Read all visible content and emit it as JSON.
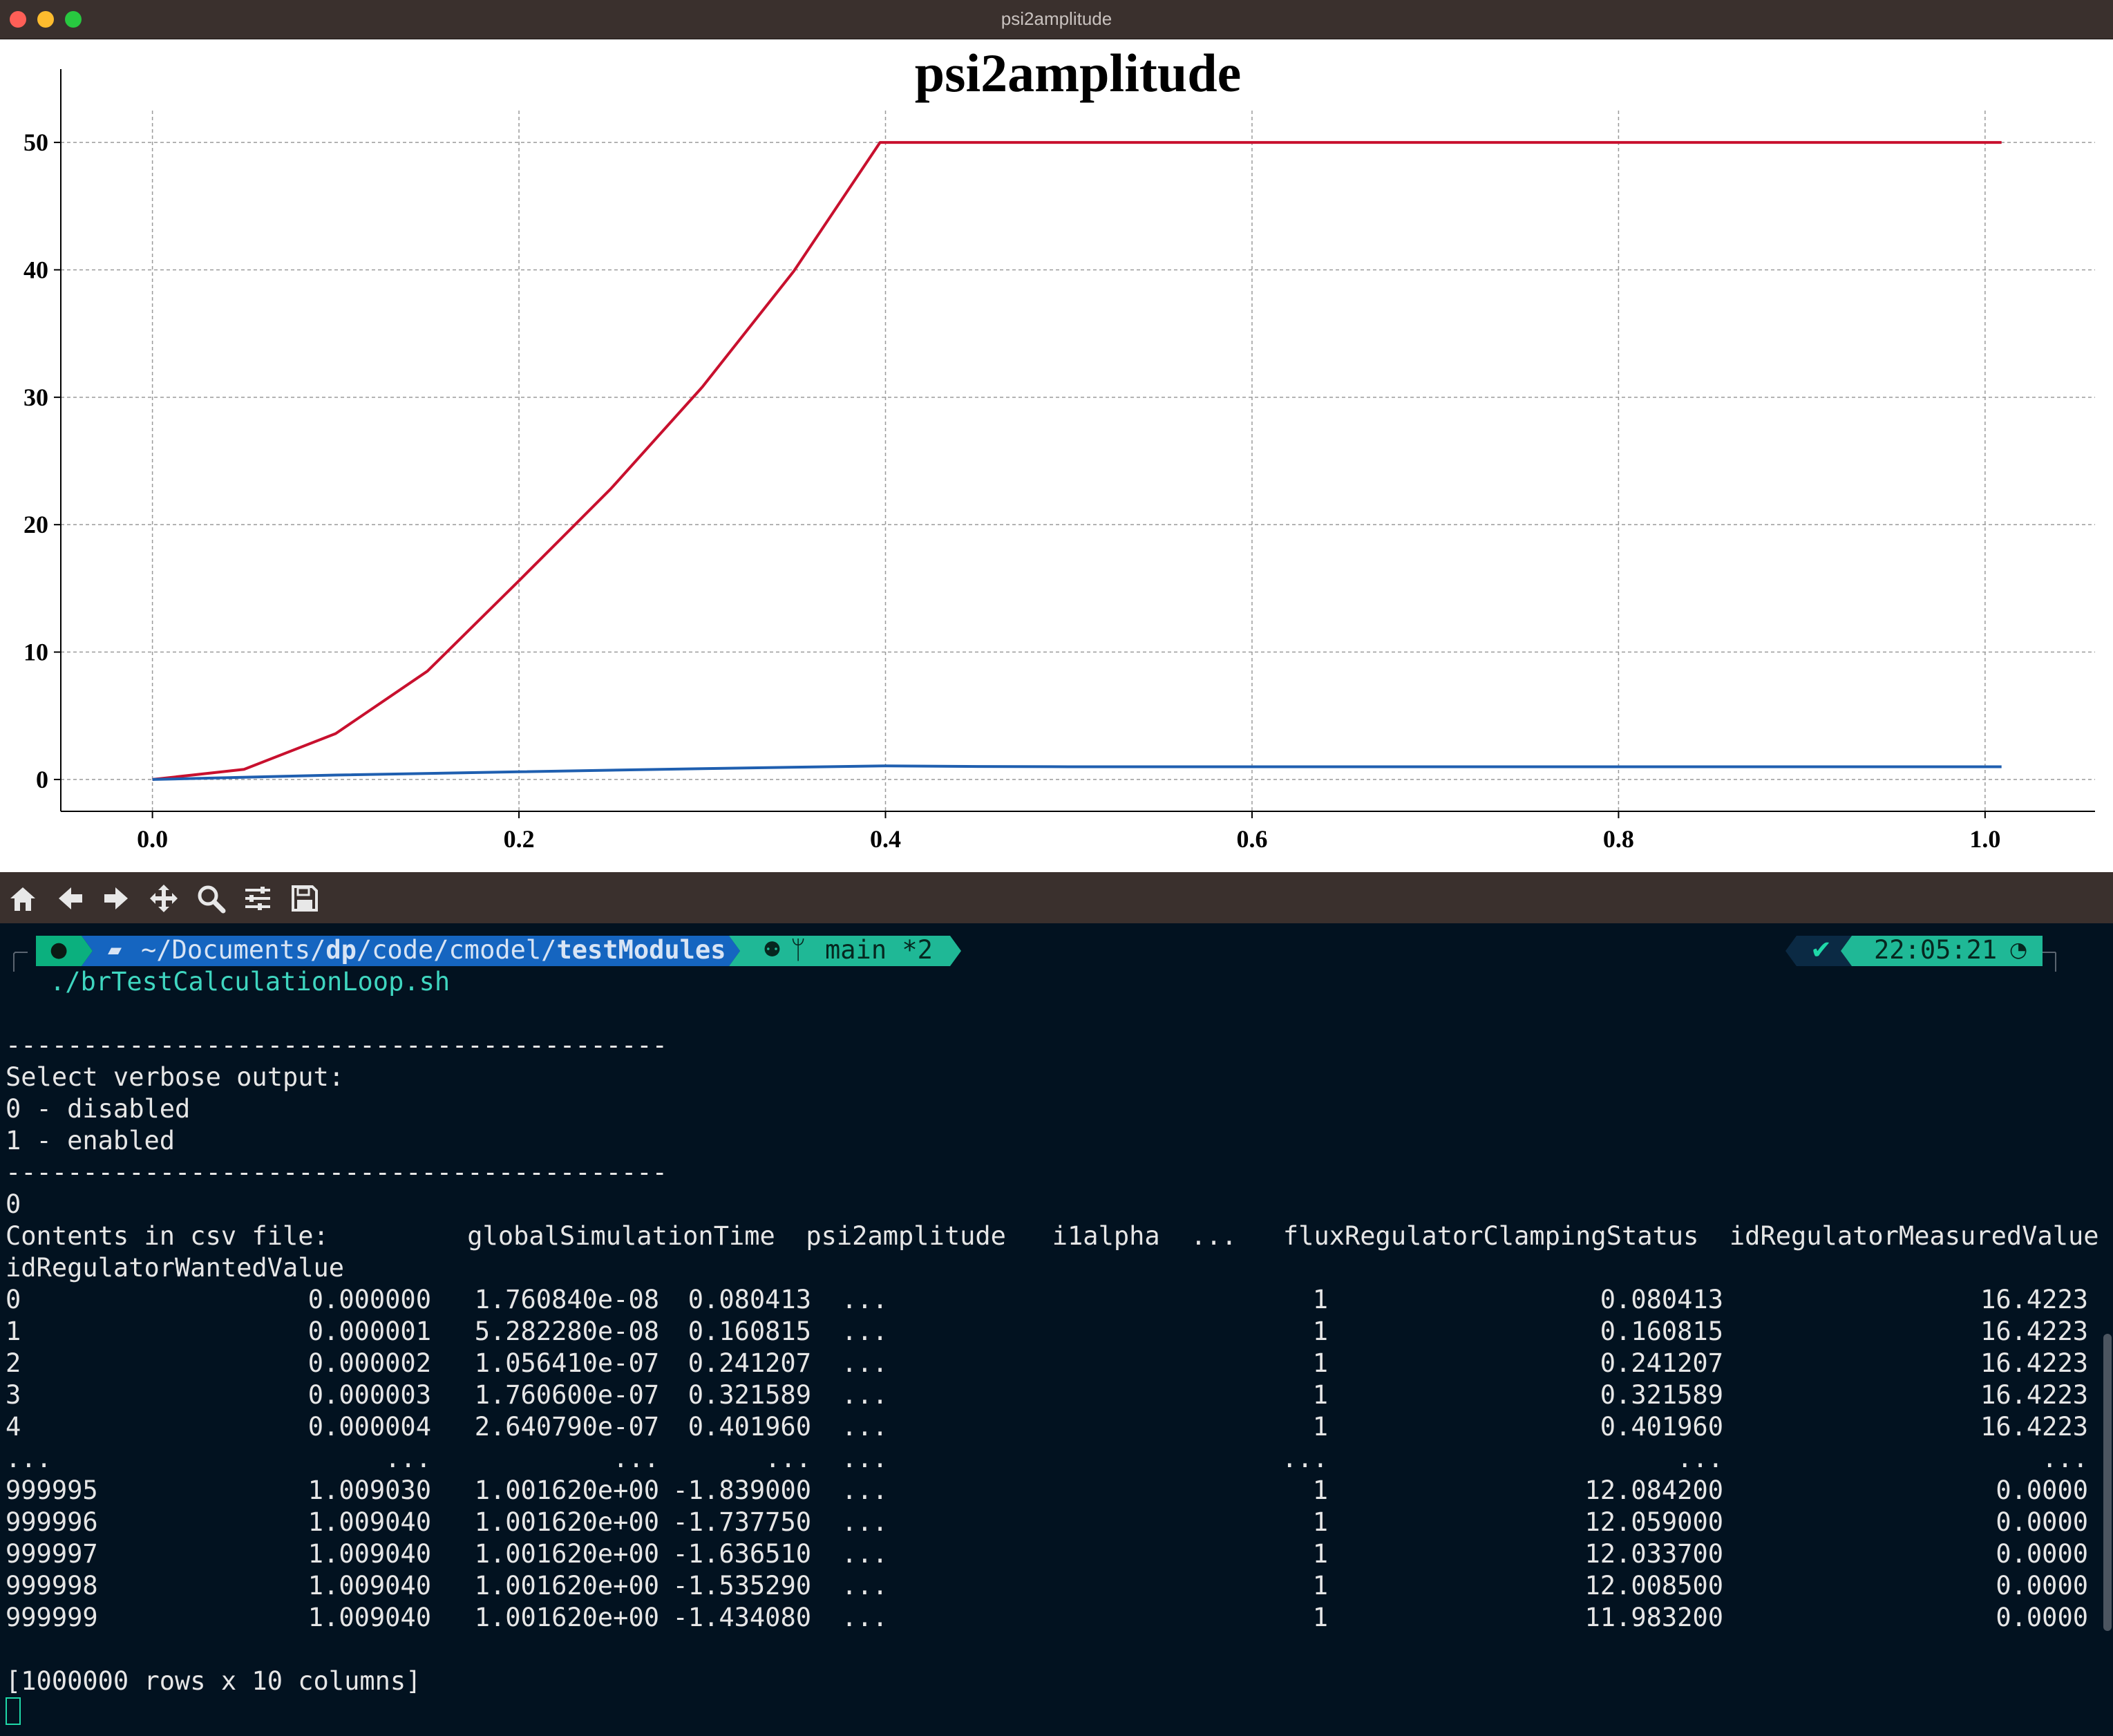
{
  "window": {
    "title": "psi2amplitude"
  },
  "chart_data": {
    "type": "line",
    "title": "psi2amplitude",
    "xlabel": "",
    "ylabel": "",
    "xlim": [
      -0.05,
      1.06
    ],
    "ylim": [
      -2.5,
      52.5
    ],
    "x_ticks": [
      "0.0",
      "0.2",
      "0.4",
      "0.6",
      "0.8",
      "1.0"
    ],
    "y_ticks": [
      "0",
      "10",
      "20",
      "30",
      "40",
      "50"
    ],
    "grid": true,
    "series": [
      {
        "color": "#c8102e",
        "x": [
          0.0,
          0.05,
          0.1,
          0.15,
          0.2,
          0.25,
          0.3,
          0.35,
          0.397,
          0.5,
          0.6,
          0.7,
          0.8,
          0.9,
          1.009
        ],
        "y": [
          0.0,
          0.8,
          3.6,
          8.5,
          15.6,
          22.8,
          30.8,
          39.9,
          50.0,
          50.0,
          50.0,
          50.0,
          50.0,
          50.0,
          50.0
        ]
      },
      {
        "color": "#1f5fb0",
        "x": [
          0.0,
          0.1,
          0.2,
          0.3,
          0.4,
          0.45,
          0.5,
          0.6,
          0.7,
          0.8,
          0.9,
          1.009
        ],
        "y": [
          0.0,
          0.35,
          0.6,
          0.85,
          1.07,
          1.02,
          1.0,
          1.0,
          1.0,
          1.0,
          1.0,
          1.0
        ]
      }
    ]
  },
  "toolbar": {
    "buttons": [
      "home-icon",
      "back-arrow-icon",
      "forward-arrow-icon",
      "pan-icon",
      "zoom-icon",
      "configure-subplots-icon",
      "save-icon"
    ]
  },
  "prompt": {
    "path_prefix": "~/Documents/",
    "path_bold1": "dp",
    "path_mid": "/code/cmodel/",
    "path_bold2": "testModules",
    "branch": "main *2",
    "status_check": "✔",
    "time": "22:05:21"
  },
  "terminal": {
    "command": "./brTestCalculationLoop.sh",
    "separator1": "-------------------------------------------",
    "verbose_prompt": "Select verbose output:",
    "option0": "0 - disabled",
    "option1": "1 - enabled",
    "separator2": "-------------------------------------------",
    "input": "0",
    "csv_header": "Contents in csv file:         globalSimulationTime  psi2amplitude   i1alpha  ...   fluxRegulatorClampingStatus  idRegulatorMeasuredValue",
    "csv_header_wrap": "idRegulatorWantedValue",
    "rows": [
      {
        "idx": "0",
        "t": "0.000000",
        "psi": "1.760840e-08",
        "i1": "0.080413",
        "dots": "...",
        "flux": "1",
        "meas": "0.080413",
        "want": "16.4223"
      },
      {
        "idx": "1",
        "t": "0.000001",
        "psi": "5.282280e-08",
        "i1": "0.160815",
        "dots": "...",
        "flux": "1",
        "meas": "0.160815",
        "want": "16.4223"
      },
      {
        "idx": "2",
        "t": "0.000002",
        "psi": "1.056410e-07",
        "i1": "0.241207",
        "dots": "...",
        "flux": "1",
        "meas": "0.241207",
        "want": "16.4223"
      },
      {
        "idx": "3",
        "t": "0.000003",
        "psi": "1.760600e-07",
        "i1": "0.321589",
        "dots": "...",
        "flux": "1",
        "meas": "0.321589",
        "want": "16.4223"
      },
      {
        "idx": "4",
        "t": "0.000004",
        "psi": "2.640790e-07",
        "i1": "0.401960",
        "dots": "...",
        "flux": "1",
        "meas": "0.401960",
        "want": "16.4223"
      },
      {
        "idx": "...",
        "t": "...",
        "psi": "...",
        "i1": "...",
        "dots": "...",
        "flux": "...",
        "meas": "...",
        "want": "..."
      },
      {
        "idx": "999995",
        "t": "1.009030",
        "psi": "1.001620e+00",
        "i1": "-1.839000",
        "dots": "...",
        "flux": "1",
        "meas": "12.084200",
        "want": "0.0000"
      },
      {
        "idx": "999996",
        "t": "1.009040",
        "psi": "1.001620e+00",
        "i1": "-1.737750",
        "dots": "...",
        "flux": "1",
        "meas": "12.059000",
        "want": "0.0000"
      },
      {
        "idx": "999997",
        "t": "1.009040",
        "psi": "1.001620e+00",
        "i1": "-1.636510",
        "dots": "...",
        "flux": "1",
        "meas": "12.033700",
        "want": "0.0000"
      },
      {
        "idx": "999998",
        "t": "1.009040",
        "psi": "1.001620e+00",
        "i1": "-1.535290",
        "dots": "...",
        "flux": "1",
        "meas": "12.008500",
        "want": "0.0000"
      },
      {
        "idx": "999999",
        "t": "1.009040",
        "psi": "1.001620e+00",
        "i1": "-1.434080",
        "dots": "...",
        "flux": "1",
        "meas": "11.983200",
        "want": "0.0000"
      }
    ],
    "summary": "[1000000 rows x 10 columns]"
  }
}
